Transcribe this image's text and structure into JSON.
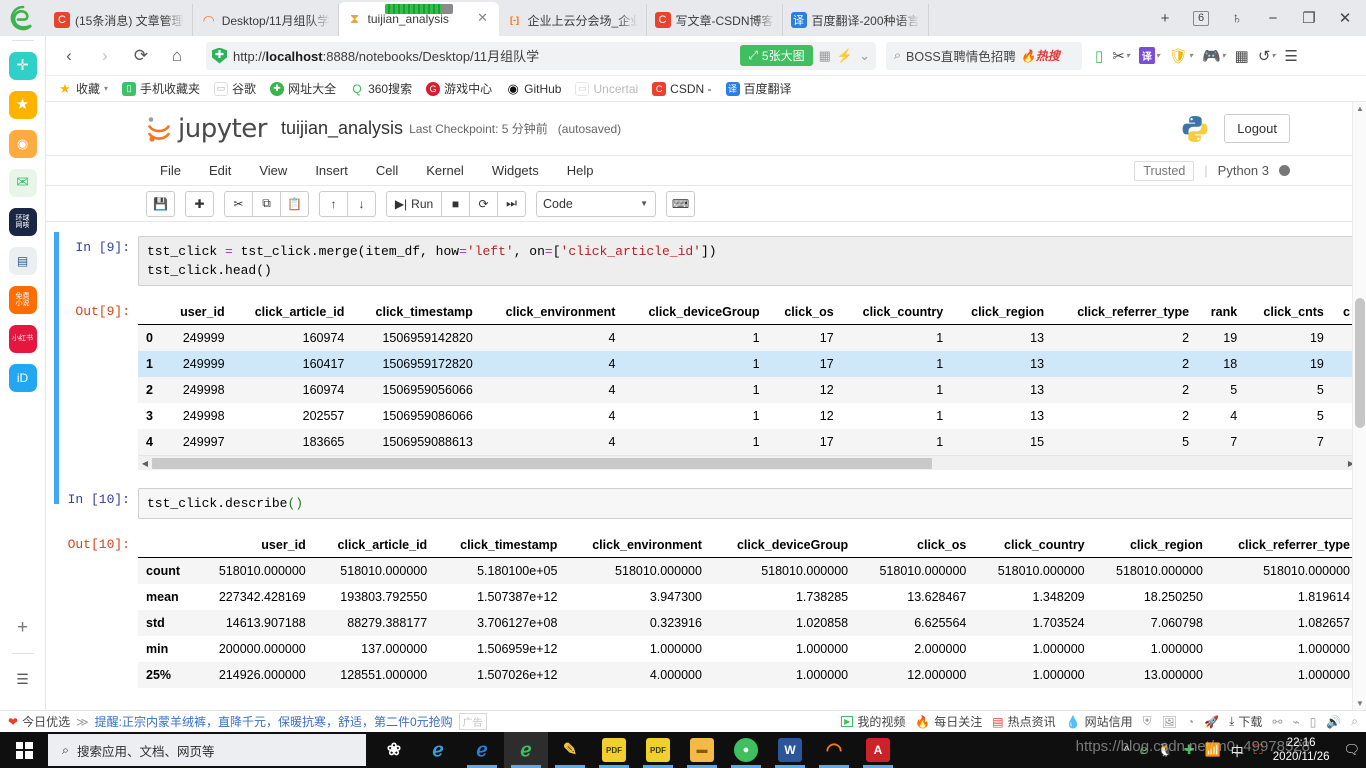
{
  "browser": {
    "tabs": [
      {
        "label": "(15条消息) 文章管理",
        "favicon": "csdn-icon",
        "fav_bg": "#e8412c",
        "fav_text": "C",
        "active": false
      },
      {
        "label": "Desktop/11月组队学",
        "favicon": "jupyter-icon",
        "fav_bg": "#ffffff",
        "fav_text": "◠",
        "active": false
      },
      {
        "label": "tuijian_analysis",
        "favicon": "hourglass-icon",
        "fav_bg": "#ffffff",
        "fav_text": "⧗",
        "active": true
      },
      {
        "label": "企业上云分会场_企业",
        "favicon": "aliyun-icon",
        "fav_bg": "#ffffff",
        "fav_text": "[-]",
        "active": false
      },
      {
        "label": "写文章-CSDN博客",
        "favicon": "csdn-icon",
        "fav_bg": "#e8412c",
        "fav_text": "C",
        "active": false
      },
      {
        "label": "百度翻译-200种语言",
        "favicon": "fanyi-icon",
        "fav_bg": "#2a7fe0",
        "fav_text": "译",
        "active": false
      }
    ],
    "new_tab_label": "+",
    "tab_count": "6",
    "window_controls": {
      "minimize": "−",
      "maximize": "❐",
      "close": "✕"
    },
    "nav": {
      "back": "‹",
      "forward": "›",
      "reload": "⟳",
      "home": "⌂"
    },
    "address": {
      "protocol_host": "http://",
      "host_bold": "localhost",
      "rest": ":8888/notebooks/Desktop/11月组队学",
      "badge": "5张大图",
      "shield_icon": "security-shield-icon"
    },
    "search": {
      "placeholder": "BOSS直聘情色招聘",
      "hot_label": "热搜"
    },
    "bookmarks": [
      {
        "label": "收藏",
        "bg": "#ffb400",
        "glyph": "★"
      },
      {
        "label": "手机收藏夹",
        "bg": "#3ec16b",
        "glyph": "▯"
      },
      {
        "label": "谷歌",
        "bg": "#ffffff",
        "glyph": "▭"
      },
      {
        "label": "网址大全",
        "bg": "#3cb44b",
        "glyph": "✚"
      },
      {
        "label": "360搜索",
        "bg": "#ffffff",
        "glyph": "Q"
      },
      {
        "label": "游戏中心",
        "bg": "#d81e2c",
        "glyph": "G"
      },
      {
        "label": "GitHub",
        "bg": "#ffffff",
        "glyph": "◉"
      },
      {
        "label": "Uncertai",
        "bg": "#ffffff",
        "glyph": "▭"
      },
      {
        "label": "CSDN -",
        "bg": "#e8412c",
        "glyph": "C"
      },
      {
        "label": "百度翻译",
        "bg": "#2a7fe0",
        "glyph": "译"
      }
    ]
  },
  "rail": {
    "items": [
      {
        "name": "clover-icon",
        "bg": "#2fd0c8",
        "glyph": "✛"
      },
      {
        "name": "favorites-star-icon",
        "bg": "#ffb300",
        "glyph": "★"
      },
      {
        "name": "weibo-icon",
        "bg": "#ffab40",
        "glyph": "◉"
      },
      {
        "name": "mail-icon",
        "bg": "#e8f5e9",
        "glyph": "✉"
      },
      {
        "name": "huanqiu-icon",
        "bg": "#1a2744",
        "glyph": "环球\n网咳"
      },
      {
        "name": "word-doc-icon",
        "bg": "#eceff1",
        "glyph": "W"
      },
      {
        "name": "free-novel-icon",
        "bg": "#ff6d00",
        "glyph": "免费\n小说"
      },
      {
        "name": "xiaohongshu-icon",
        "bg": "#e5173f",
        "glyph": "小红书"
      },
      {
        "name": "iqiyi-icon",
        "bg": "#22a7f0",
        "glyph": "iD"
      }
    ],
    "add_label": "+",
    "list_label": "☰"
  },
  "jupyter": {
    "brand": "jupyter",
    "notebook_name": "tuijian_analysis",
    "checkpoint": "Last Checkpoint: 5 分钟前",
    "autosaved": "(autosaved)",
    "logout_label": "Logout",
    "trusted_label": "Trusted",
    "kernel_name": "Python 3",
    "menus": [
      "File",
      "Edit",
      "View",
      "Insert",
      "Cell",
      "Kernel",
      "Widgets",
      "Help"
    ],
    "toolbar": {
      "save": "💾",
      "insert": "✚",
      "cut": "✂",
      "copy": "⧉",
      "paste": "📋",
      "moveup": "↑",
      "movedown": "↓",
      "run": "Run",
      "stop": "■",
      "restart": "⟳",
      "runall": "⏭",
      "celltype": "Code",
      "keyboard": "⌨"
    }
  },
  "cells": [
    {
      "in_label": "In  [9]:",
      "out_label": "Out[9]:",
      "code_line1_a": "tst_click ",
      "code_line1_op1": "=",
      "code_line1_b": " tst_click.merge(item_df, how",
      "code_line1_op2": "=",
      "code_line1_str1": "'left'",
      "code_line1_c": ", on",
      "code_line1_op3": "=",
      "code_line1_d": "[",
      "code_line1_str2": "'click_article_id'",
      "code_line1_e": "])",
      "code_line2": "tst_click.head()",
      "table": {
        "columns": [
          "",
          "user_id",
          "click_article_id",
          "click_timestamp",
          "click_environment",
          "click_deviceGroup",
          "click_os",
          "click_country",
          "click_region",
          "click_referrer_type",
          "rank",
          "click_cnts",
          "c"
        ],
        "rows": [
          [
            "0",
            "249999",
            "160974",
            "1506959142820",
            "4",
            "1",
            "17",
            "1",
            "13",
            "2",
            "19",
            "19",
            ""
          ],
          [
            "1",
            "249999",
            "160417",
            "1506959172820",
            "4",
            "1",
            "17",
            "1",
            "13",
            "2",
            "18",
            "19",
            ""
          ],
          [
            "2",
            "249998",
            "160974",
            "1506959056066",
            "4",
            "1",
            "12",
            "1",
            "13",
            "2",
            "5",
            "5",
            ""
          ],
          [
            "3",
            "249998",
            "202557",
            "1506959086066",
            "4",
            "1",
            "12",
            "1",
            "13",
            "2",
            "4",
            "5",
            ""
          ],
          [
            "4",
            "249997",
            "183665",
            "1506959088613",
            "4",
            "1",
            "17",
            "1",
            "15",
            "5",
            "7",
            "7",
            ""
          ]
        ],
        "highlight_row_index": 1
      }
    },
    {
      "in_label": "In  [10]:",
      "out_label": "Out[10]:",
      "code_line1": "tst_click.describe",
      "code_line1_paren": "()",
      "table": {
        "columns": [
          "",
          "user_id",
          "click_article_id",
          "click_timestamp",
          "click_environment",
          "click_deviceGroup",
          "click_os",
          "click_country",
          "click_region",
          "click_referrer_type"
        ],
        "rows": [
          [
            "count",
            "518010.000000",
            "518010.000000",
            "5.180100e+05",
            "518010.000000",
            "518010.000000",
            "518010.000000",
            "518010.000000",
            "518010.000000",
            "518010.000000"
          ],
          [
            "mean",
            "227342.428169",
            "193803.792550",
            "1.507387e+12",
            "3.947300",
            "1.738285",
            "13.628467",
            "1.348209",
            "18.250250",
            "1.819614"
          ],
          [
            "std",
            "14613.907188",
            "88279.388177",
            "3.706127e+08",
            "0.323916",
            "1.020858",
            "6.625564",
            "1.703524",
            "7.060798",
            "1.082657"
          ],
          [
            "min",
            "200000.000000",
            "137.000000",
            "1.506959e+12",
            "1.000000",
            "1.000000",
            "2.000000",
            "1.000000",
            "1.000000",
            "1.000000"
          ],
          [
            "25%",
            "214926.000000",
            "128551.000000",
            "1.507026e+12",
            "4.000000",
            "1.000000",
            "12.000000",
            "1.000000",
            "13.000000",
            "1.000000"
          ]
        ]
      }
    }
  ],
  "statusbar": {
    "left_label": "今日优选",
    "ad_text": "提醒:正宗内蒙羊绒裤，直降千元，保暖抗寒，舒适，第二件0元抢购",
    "ad_tag": "广告",
    "items": [
      {
        "label": "我的视频",
        "glyph": "▶"
      },
      {
        "label": "每日关注",
        "glyph": "🔥"
      },
      {
        "label": "热点资讯",
        "glyph": "▤"
      },
      {
        "label": "网站信用",
        "glyph": "💧"
      }
    ],
    "icons": [
      "shield-icon",
      "image-icon",
      "clock-icon",
      "rocket-icon"
    ],
    "download_label": "下载",
    "trailing_icons": [
      "link-icon",
      "lasso-icon",
      "phone-icon",
      "sound-icon",
      "search-icon"
    ]
  },
  "taskbar": {
    "search_placeholder": "搜索应用、文档、网页等",
    "apps": [
      {
        "name": "fan-icon",
        "bg": "#1f1f1f",
        "glyph": "❀",
        "color": "#ffffff",
        "active": false,
        "underline": false
      },
      {
        "name": "ie-icon",
        "bg": "#1f1f1f",
        "glyph": "e",
        "color": "#38a0e0",
        "active": false,
        "underline": false
      },
      {
        "name": "edge-icon",
        "bg": "#1f1f1f",
        "glyph": "e",
        "color": "#2a7fd0",
        "active": false,
        "underline": true
      },
      {
        "name": "360-browser-icon",
        "bg": "#2d2d2d",
        "glyph": "e",
        "color": "#3fbf5f",
        "active": true,
        "underline": true
      },
      {
        "name": "editor-pen-icon",
        "bg": "#1f1f1f",
        "glyph": "✎",
        "color": "#f4c542",
        "active": false,
        "underline": true
      },
      {
        "name": "pdf-icon",
        "bg": "#f0cf2e",
        "glyph": "PDF",
        "color": "#3d3d00",
        "active": false,
        "underline": true
      },
      {
        "name": "pdf2-icon",
        "bg": "#f0cf2e",
        "glyph": "PDF",
        "color": "#3d3d00",
        "active": false,
        "underline": true
      },
      {
        "name": "folder-icon",
        "bg": "#f5b945",
        "glyph": "▬",
        "color": "#8a5b00",
        "active": false,
        "underline": true
      },
      {
        "name": "wechat-icon",
        "bg": "#3fbf5f",
        "glyph": "●",
        "color": "#ffffff",
        "active": false,
        "underline": true
      },
      {
        "name": "word-icon",
        "bg": "#2b579a",
        "glyph": "W",
        "color": "#ffffff",
        "active": false,
        "underline": true
      },
      {
        "name": "jupyter-icon",
        "bg": "#1f1f1f",
        "glyph": "◠",
        "color": "#f37726",
        "active": false,
        "underline": true
      },
      {
        "name": "acrobat-icon",
        "bg": "#cc2229",
        "glyph": "A",
        "color": "#ffffff",
        "active": false,
        "underline": true
      }
    ],
    "tray": [
      "^",
      "360-icon",
      "qq-icon",
      "plus-icon",
      "network-icon",
      "ime-icon",
      "app-icon"
    ],
    "time": "22:16",
    "date": "2020/11/26"
  },
  "watermark": "https://blog.csdn.net/m0_49978528"
}
